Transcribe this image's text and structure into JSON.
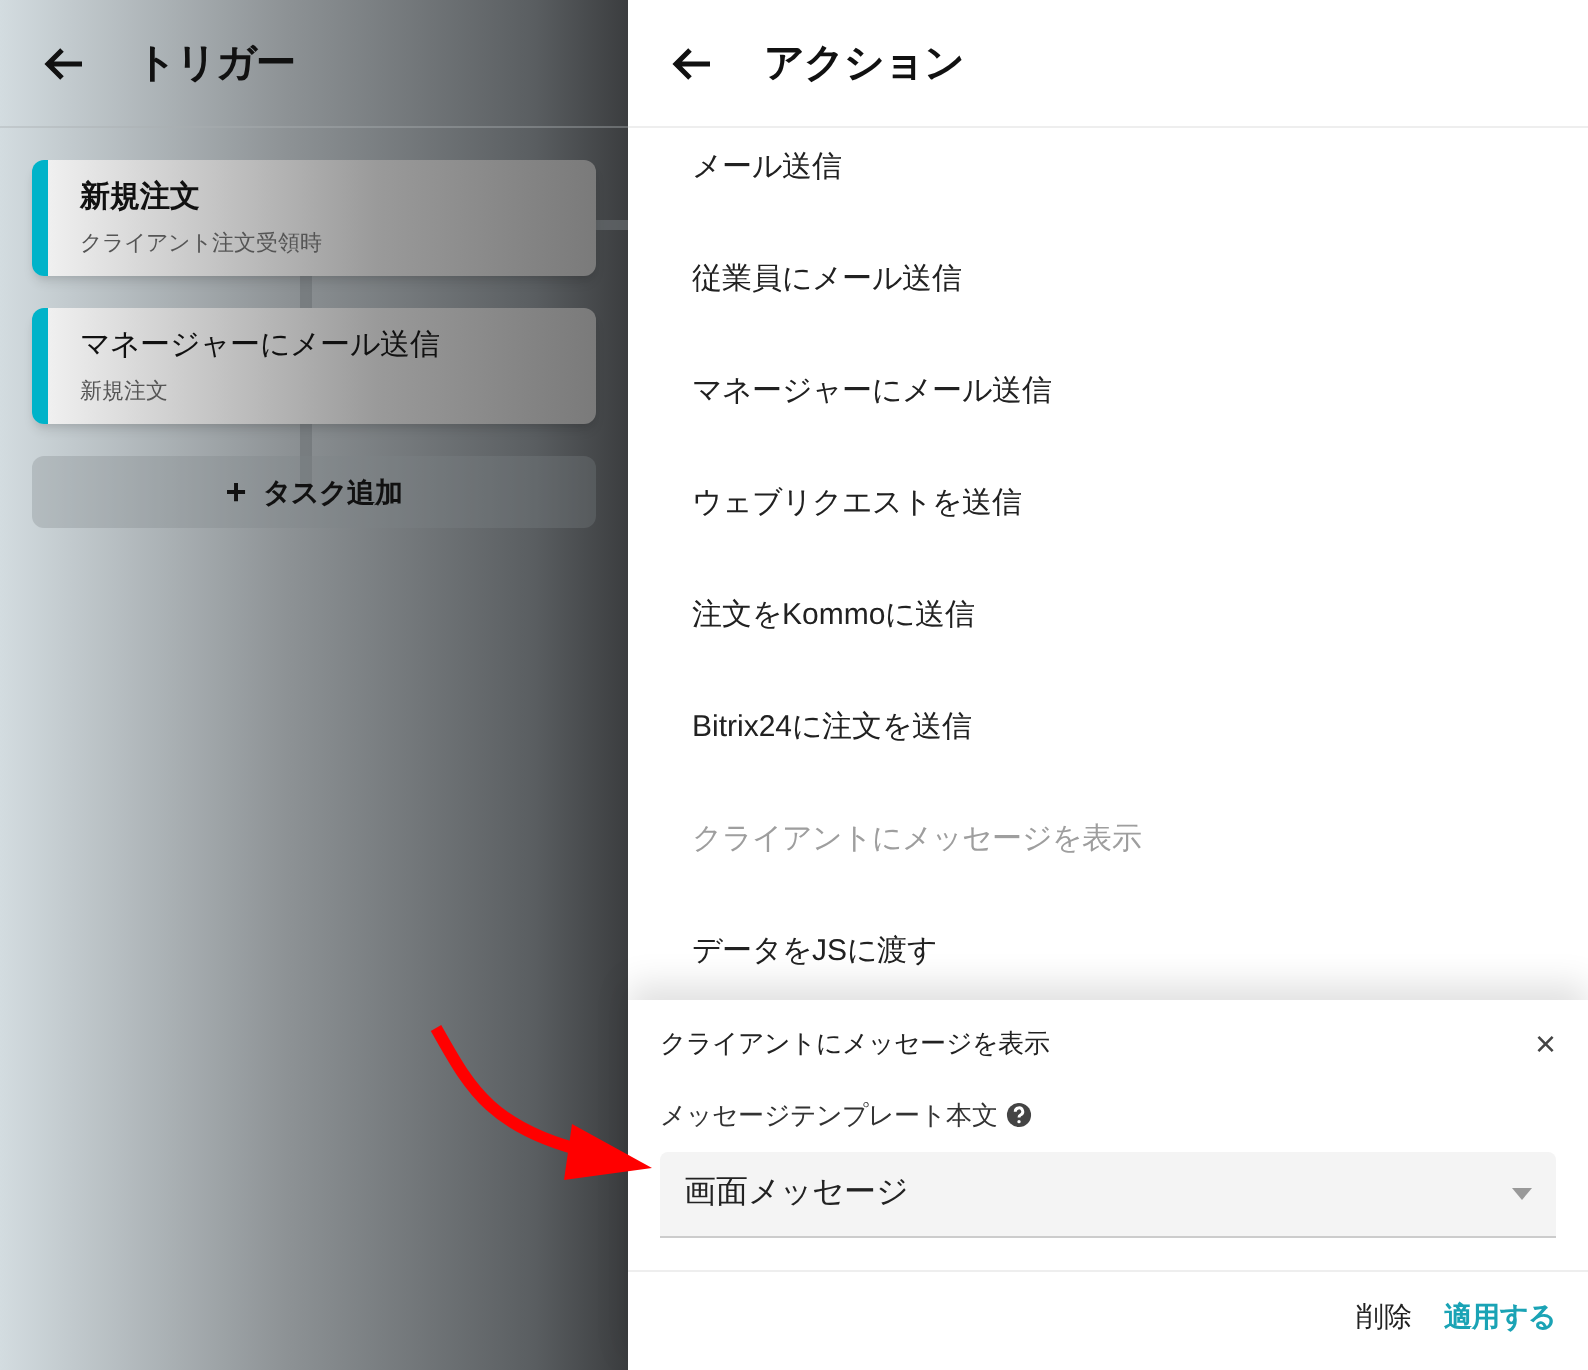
{
  "trigger_panel": {
    "title": "トリガー",
    "cards": [
      {
        "title": "新規注文",
        "subtitle": "クライアント注文受領時"
      },
      {
        "title": "マネージャーにメール送信",
        "subtitle": "新規注文"
      }
    ],
    "add_task_button": {
      "icon": "+",
      "label": "タスク追加"
    }
  },
  "action_panel": {
    "title": "アクション",
    "items": [
      {
        "label": "メール送信",
        "disabled": false
      },
      {
        "label": "従業員にメール送信",
        "disabled": false
      },
      {
        "label": "マネージャーにメール送信",
        "disabled": false
      },
      {
        "label": "ウェブリクエストを送信",
        "disabled": false
      },
      {
        "label": "注文をKommoに送信",
        "disabled": false
      },
      {
        "label": "Bitrix24に注文を送信",
        "disabled": false
      },
      {
        "label": "クライアントにメッセージを表示",
        "disabled": true
      },
      {
        "label": "データをJSに渡す",
        "disabled": false
      }
    ]
  },
  "settings_sheet": {
    "title": "クライアントにメッセージを表示",
    "close": "×",
    "field_label": "メッセージテンプレート本文",
    "field_value": "画面メッセージ",
    "buttons": [
      {
        "label": "削除",
        "kind": "plain"
      },
      {
        "label": "適用する",
        "kind": "primary"
      }
    ]
  }
}
